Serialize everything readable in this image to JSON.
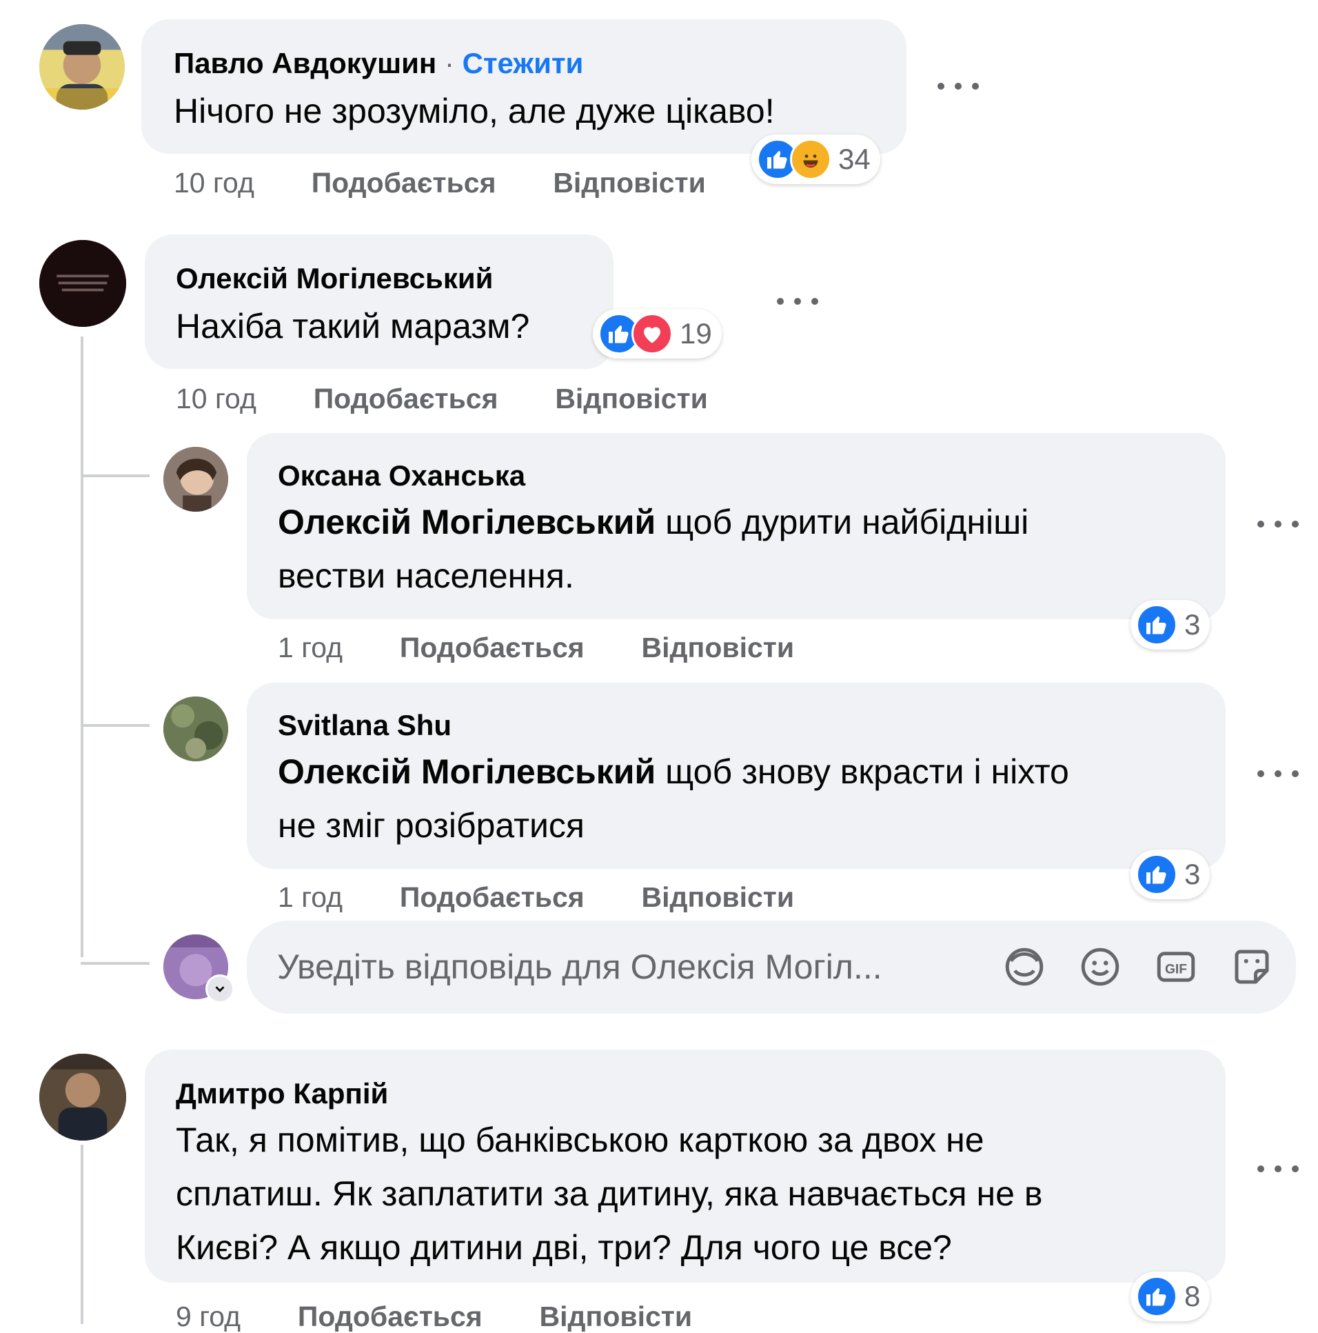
{
  "comments": [
    {
      "author": "Павло Авдокушин",
      "follow_label": "Стежити",
      "separator": "·",
      "text": "Нічого не зрозуміло, але дуже цікаво!",
      "time": "10 год",
      "like_label": "Подобається",
      "reply_label": "Відповісти",
      "reactions": [
        "like-icon",
        "haha-icon"
      ],
      "reaction_count": "34"
    },
    {
      "author": "Олексій Могілевський",
      "text": "Нахіба такий маразм?",
      "time": "10 год",
      "like_label": "Подобається",
      "reply_label": "Відповісти",
      "reactions": [
        "like-icon",
        "love-icon"
      ],
      "reaction_count": "19",
      "replies": [
        {
          "author": "Оксана Оханська",
          "mention": "Олексій Могілевський",
          "text_line1": " щоб дурити найбідніші",
          "text_line2": "вестви населення.",
          "time": "1 год",
          "like_label": "Подобається",
          "reply_label": "Відповісти",
          "reactions": [
            "like-icon"
          ],
          "reaction_count": "3"
        },
        {
          "author": "Svitlana Shu",
          "mention": "Олексій Могілевський",
          "text_line1": " щоб знову вкрасти і ніхто",
          "text_line2": "не зміг розібратися",
          "time": "1 год",
          "like_label": "Подобається",
          "reply_label": "Відповісти",
          "reactions": [
            "like-icon"
          ],
          "reaction_count": "3"
        }
      ],
      "reply_input": {
        "placeholder": "Уведіть відповідь для Олексія Могіл...",
        "icons": [
          "avatar-sticker-icon",
          "emoji-icon",
          "gif-icon",
          "sticker-icon"
        ]
      }
    },
    {
      "author": "Дмитро Карпій",
      "text_line1": "Так, я помітив, що банківською карткою за двох не",
      "text_line2": "сплатиш. Як заплатити за дитину, яка навчається не в",
      "text_line3": "Києві? А якщо дитини дві, три? Для чого це все?",
      "time": "9 год",
      "like_label": "Подобається",
      "reply_label": "Відповісти",
      "reactions": [
        "like-icon"
      ],
      "reaction_count": "8"
    }
  ],
  "colors": {
    "bubble": "#f0f2f5",
    "link": "#1877f2",
    "meta": "#65676b",
    "like": "#1877f2",
    "love": "#f33e58",
    "haha": "#f7b125"
  }
}
